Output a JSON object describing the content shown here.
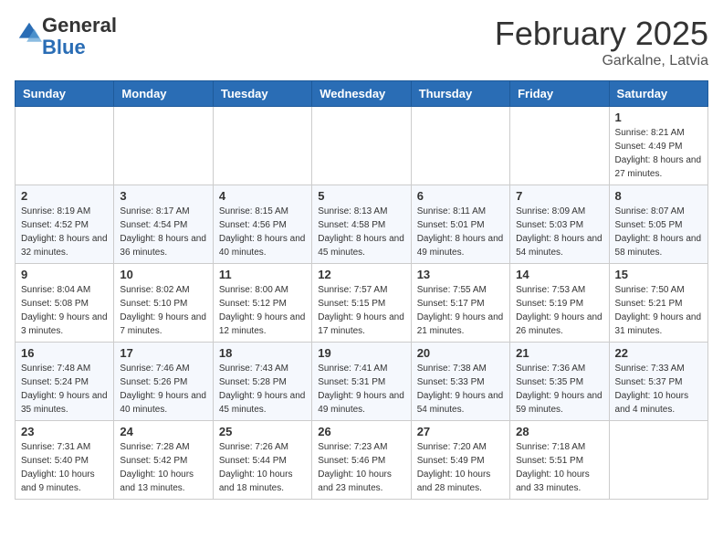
{
  "logo": {
    "general": "General",
    "blue": "Blue"
  },
  "header": {
    "title": "February 2025",
    "subtitle": "Garkalne, Latvia"
  },
  "weekdays": [
    "Sunday",
    "Monday",
    "Tuesday",
    "Wednesday",
    "Thursday",
    "Friday",
    "Saturday"
  ],
  "weeks": [
    [
      {
        "day": "",
        "info": ""
      },
      {
        "day": "",
        "info": ""
      },
      {
        "day": "",
        "info": ""
      },
      {
        "day": "",
        "info": ""
      },
      {
        "day": "",
        "info": ""
      },
      {
        "day": "",
        "info": ""
      },
      {
        "day": "1",
        "info": "Sunrise: 8:21 AM\nSunset: 4:49 PM\nDaylight: 8 hours and 27 minutes."
      }
    ],
    [
      {
        "day": "2",
        "info": "Sunrise: 8:19 AM\nSunset: 4:52 PM\nDaylight: 8 hours and 32 minutes."
      },
      {
        "day": "3",
        "info": "Sunrise: 8:17 AM\nSunset: 4:54 PM\nDaylight: 8 hours and 36 minutes."
      },
      {
        "day": "4",
        "info": "Sunrise: 8:15 AM\nSunset: 4:56 PM\nDaylight: 8 hours and 40 minutes."
      },
      {
        "day": "5",
        "info": "Sunrise: 8:13 AM\nSunset: 4:58 PM\nDaylight: 8 hours and 45 minutes."
      },
      {
        "day": "6",
        "info": "Sunrise: 8:11 AM\nSunset: 5:01 PM\nDaylight: 8 hours and 49 minutes."
      },
      {
        "day": "7",
        "info": "Sunrise: 8:09 AM\nSunset: 5:03 PM\nDaylight: 8 hours and 54 minutes."
      },
      {
        "day": "8",
        "info": "Sunrise: 8:07 AM\nSunset: 5:05 PM\nDaylight: 8 hours and 58 minutes."
      }
    ],
    [
      {
        "day": "9",
        "info": "Sunrise: 8:04 AM\nSunset: 5:08 PM\nDaylight: 9 hours and 3 minutes."
      },
      {
        "day": "10",
        "info": "Sunrise: 8:02 AM\nSunset: 5:10 PM\nDaylight: 9 hours and 7 minutes."
      },
      {
        "day": "11",
        "info": "Sunrise: 8:00 AM\nSunset: 5:12 PM\nDaylight: 9 hours and 12 minutes."
      },
      {
        "day": "12",
        "info": "Sunrise: 7:57 AM\nSunset: 5:15 PM\nDaylight: 9 hours and 17 minutes."
      },
      {
        "day": "13",
        "info": "Sunrise: 7:55 AM\nSunset: 5:17 PM\nDaylight: 9 hours and 21 minutes."
      },
      {
        "day": "14",
        "info": "Sunrise: 7:53 AM\nSunset: 5:19 PM\nDaylight: 9 hours and 26 minutes."
      },
      {
        "day": "15",
        "info": "Sunrise: 7:50 AM\nSunset: 5:21 PM\nDaylight: 9 hours and 31 minutes."
      }
    ],
    [
      {
        "day": "16",
        "info": "Sunrise: 7:48 AM\nSunset: 5:24 PM\nDaylight: 9 hours and 35 minutes."
      },
      {
        "day": "17",
        "info": "Sunrise: 7:46 AM\nSunset: 5:26 PM\nDaylight: 9 hours and 40 minutes."
      },
      {
        "day": "18",
        "info": "Sunrise: 7:43 AM\nSunset: 5:28 PM\nDaylight: 9 hours and 45 minutes."
      },
      {
        "day": "19",
        "info": "Sunrise: 7:41 AM\nSunset: 5:31 PM\nDaylight: 9 hours and 49 minutes."
      },
      {
        "day": "20",
        "info": "Sunrise: 7:38 AM\nSunset: 5:33 PM\nDaylight: 9 hours and 54 minutes."
      },
      {
        "day": "21",
        "info": "Sunrise: 7:36 AM\nSunset: 5:35 PM\nDaylight: 9 hours and 59 minutes."
      },
      {
        "day": "22",
        "info": "Sunrise: 7:33 AM\nSunset: 5:37 PM\nDaylight: 10 hours and 4 minutes."
      }
    ],
    [
      {
        "day": "23",
        "info": "Sunrise: 7:31 AM\nSunset: 5:40 PM\nDaylight: 10 hours and 9 minutes."
      },
      {
        "day": "24",
        "info": "Sunrise: 7:28 AM\nSunset: 5:42 PM\nDaylight: 10 hours and 13 minutes."
      },
      {
        "day": "25",
        "info": "Sunrise: 7:26 AM\nSunset: 5:44 PM\nDaylight: 10 hours and 18 minutes."
      },
      {
        "day": "26",
        "info": "Sunrise: 7:23 AM\nSunset: 5:46 PM\nDaylight: 10 hours and 23 minutes."
      },
      {
        "day": "27",
        "info": "Sunrise: 7:20 AM\nSunset: 5:49 PM\nDaylight: 10 hours and 28 minutes."
      },
      {
        "day": "28",
        "info": "Sunrise: 7:18 AM\nSunset: 5:51 PM\nDaylight: 10 hours and 33 minutes."
      },
      {
        "day": "",
        "info": ""
      }
    ]
  ]
}
